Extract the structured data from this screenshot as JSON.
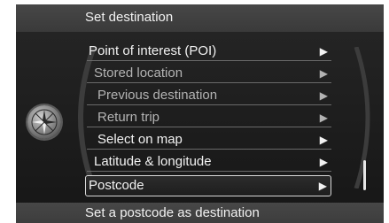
{
  "header": {
    "title": "Set destination"
  },
  "footer": {
    "hint": "Set a postcode as destination"
  },
  "menu": {
    "items": [
      {
        "label": "Point of interest (POI)",
        "arrow": "▶",
        "enabled": true,
        "selected": false
      },
      {
        "label": "Stored location",
        "arrow": "▶",
        "enabled": false,
        "selected": false
      },
      {
        "label": "Previous destination",
        "arrow": "▶",
        "enabled": false,
        "selected": false
      },
      {
        "label": "Return trip",
        "arrow": "▶",
        "enabled": false,
        "selected": false
      },
      {
        "label": "Select on map",
        "arrow": "▶",
        "enabled": true,
        "selected": false
      },
      {
        "label": "Latitude & longitude",
        "arrow": "▶",
        "enabled": true,
        "selected": false
      },
      {
        "label": "Postcode",
        "arrow": "▶",
        "enabled": true,
        "selected": true
      }
    ]
  },
  "icons": {
    "navigation": "compass-icon"
  },
  "colors": {
    "background": "#1c1c1c",
    "header_bar": "#404040",
    "text_enabled": "#f2f2f2",
    "text_disabled": "#b3b3b3"
  }
}
